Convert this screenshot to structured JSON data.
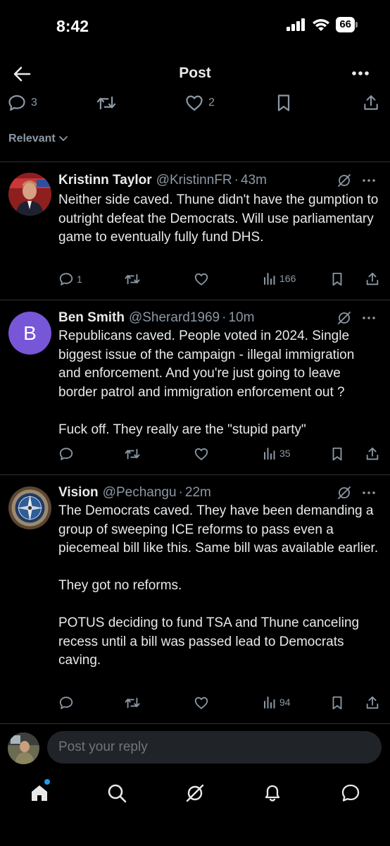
{
  "status": {
    "time": "8:42",
    "battery": "66"
  },
  "header": {
    "title": "Post"
  },
  "post_actions": {
    "replies": "3",
    "likes": "2"
  },
  "sort": {
    "label": "Relevant"
  },
  "replies": [
    {
      "name": "Kristinn Taylor",
      "handle": "@KristinnFR",
      "dot": "·",
      "time": "43m",
      "paragraphs": [
        "Neither side caved. Thune didn't have the gumption to outright defeat the Democrats. Will use parliamentary game to eventually fully fund DHS."
      ],
      "reply_count": "1",
      "views": "166"
    },
    {
      "name": "Ben Smith",
      "handle": "@Sherard1969",
      "dot": "·",
      "time": "10m",
      "avatar_letter": "B",
      "paragraphs": [
        "Republicans caved.  People voted in 2024.  Single biggest issue of the campaign - illegal immigration and enforcement.  And you're just going to leave border patrol and immigration enforcement out ?",
        "Fuck off.  They really are the \"stupid party\""
      ],
      "reply_count": "",
      "views": "35"
    },
    {
      "name": "Vision",
      "handle": "@Pechangu",
      "dot": "·",
      "time": "22m",
      "paragraphs": [
        "The Democrats caved. They have been demanding a group of sweeping ICE reforms to pass even a piecemeal bill like this. Same bill was available earlier.",
        "They got no reforms.",
        "POTUS deciding to fund TSA and Thune canceling recess until a bill was passed lead to Democrats caving."
      ],
      "reply_count": "",
      "views": "94"
    }
  ],
  "composer": {
    "placeholder": "Post your reply"
  },
  "colors": {
    "background": "#000000",
    "text": "#e7e9ea",
    "muted": "#8b98a5",
    "accent": "#1d9bf0",
    "avatar_purple": "#7856d8"
  },
  "icons": [
    "back-arrow-icon",
    "more-icon",
    "reply-icon",
    "retweet-icon",
    "heart-icon",
    "bookmark-icon",
    "share-icon",
    "grok-icon",
    "views-icon",
    "home-icon",
    "search-icon",
    "bell-icon",
    "messages-icon"
  ]
}
